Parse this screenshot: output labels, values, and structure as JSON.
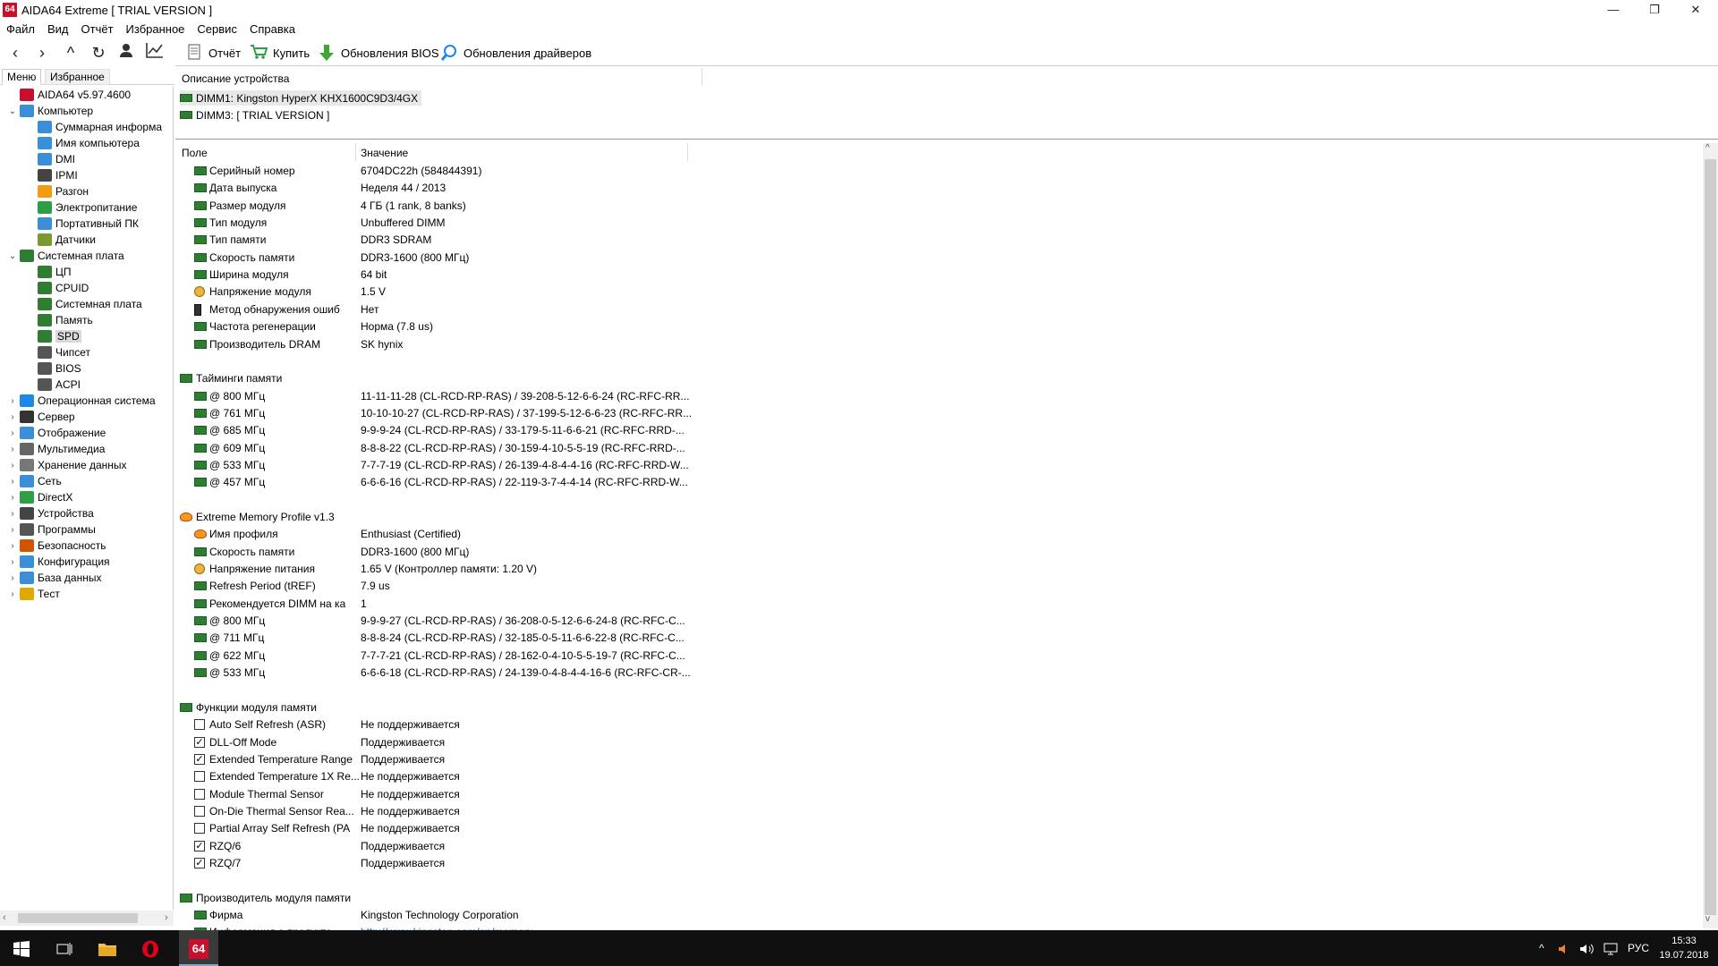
{
  "window": {
    "app_icon": "64",
    "title": "AIDA64 Extreme  [ TRIAL VERSION ]",
    "minimize": "—",
    "restore": "❐",
    "close": "✕"
  },
  "menu": [
    "Файл",
    "Вид",
    "Отчёт",
    "Избранное",
    "Сервис",
    "Справка"
  ],
  "toolbar": {
    "nav_icons": [
      "back-icon",
      "forward-icon",
      "up-icon",
      "refresh-icon",
      "user-icon",
      "chart-icon"
    ],
    "report_label": "Отчёт",
    "buy_label": "Купить",
    "bios_update_label": "Обновления BIOS",
    "driver_update_label": "Обновления драйверов"
  },
  "left_tabs": {
    "menu": "Меню",
    "favorites": "Избранное"
  },
  "tree": [
    {
      "label": "AIDA64 v5.97.4600",
      "level": 0,
      "expander": "",
      "icon_color": "#c8102e"
    },
    {
      "label": "Компьютер",
      "level": 0,
      "expander": "⌄",
      "icon_color": "#3a8fd8"
    },
    {
      "label": "Суммарная информа",
      "level": 1,
      "expander": "",
      "icon_color": "#3a8fd8"
    },
    {
      "label": "Имя компьютера",
      "level": 1,
      "expander": "",
      "icon_color": "#3a8fd8"
    },
    {
      "label": "DMI",
      "level": 1,
      "expander": "",
      "icon_color": "#3a8fd8"
    },
    {
      "label": "IPMI",
      "level": 1,
      "expander": "",
      "icon_color": "#444444"
    },
    {
      "label": "Разгон",
      "level": 1,
      "expander": "",
      "icon_color": "#f39c12"
    },
    {
      "label": "Электропитание",
      "level": 1,
      "expander": "",
      "icon_color": "#2e9e44"
    },
    {
      "label": "Портативный ПК",
      "level": 1,
      "expander": "",
      "icon_color": "#3a8fd8"
    },
    {
      "label": "Датчики",
      "level": 1,
      "expander": "",
      "icon_color": "#7a9a2e"
    },
    {
      "label": "Системная плата",
      "level": 0,
      "expander": "⌄",
      "icon_color": "#2e7d32"
    },
    {
      "label": "ЦП",
      "level": 1,
      "expander": "",
      "icon_color": "#2e7d32"
    },
    {
      "label": "CPUID",
      "level": 1,
      "expander": "",
      "icon_color": "#2e7d32"
    },
    {
      "label": "Системная плата",
      "level": 1,
      "expander": "",
      "icon_color": "#2e7d32"
    },
    {
      "label": "Память",
      "level": 1,
      "expander": "",
      "icon_color": "#2e7d32"
    },
    {
      "label": "SPD",
      "level": 1,
      "expander": "",
      "icon_color": "#2e7d32",
      "selected": true
    },
    {
      "label": "Чипсет",
      "level": 1,
      "expander": "",
      "icon_color": "#555555"
    },
    {
      "label": "BIOS",
      "level": 1,
      "expander": "",
      "icon_color": "#555555"
    },
    {
      "label": "ACPI",
      "level": 1,
      "expander": "",
      "icon_color": "#555555"
    },
    {
      "label": "Операционная система",
      "level": 0,
      "expander": "›",
      "icon_color": "#1e88e5"
    },
    {
      "label": "Сервер",
      "level": 0,
      "expander": "›",
      "icon_color": "#333333"
    },
    {
      "label": "Отображение",
      "level": 0,
      "expander": "›",
      "icon_color": "#3a8fd8"
    },
    {
      "label": "Мультимедиа",
      "level": 0,
      "expander": "›",
      "icon_color": "#666666"
    },
    {
      "label": "Хранение данных",
      "level": 0,
      "expander": "›",
      "icon_color": "#777777"
    },
    {
      "label": "Сеть",
      "level": 0,
      "expander": "›",
      "icon_color": "#3a8fd8"
    },
    {
      "label": "DirectX",
      "level": 0,
      "expander": "›",
      "icon_color": "#2ea043"
    },
    {
      "label": "Устройства",
      "level": 0,
      "expander": "›",
      "icon_color": "#444444"
    },
    {
      "label": "Программы",
      "level": 0,
      "expander": "›",
      "icon_color": "#555555"
    },
    {
      "label": "Безопасность",
      "level": 0,
      "expander": "›",
      "icon_color": "#d35400"
    },
    {
      "label": "Конфигурация",
      "level": 0,
      "expander": "›",
      "icon_color": "#3a8fd8"
    },
    {
      "label": "База данных",
      "level": 0,
      "expander": "›",
      "icon_color": "#3a8fd8"
    },
    {
      "label": "Тест",
      "level": 0,
      "expander": "›",
      "icon_color": "#e0a800"
    }
  ],
  "device_panel": {
    "header": "Описание устройства",
    "items": [
      "DIMM1: Kingston HyperX KHX1600C9D3/4GX",
      "DIMM3: [ TRIAL VERSION ]"
    ]
  },
  "detail_headers": {
    "field": "Поле",
    "value": "Значение"
  },
  "detail_rows": [
    {
      "type": "item",
      "field": "Серийный номер",
      "value": "6704DC22h (584844391)"
    },
    {
      "type": "item",
      "field": "Дата выпуска",
      "value": "Неделя 44 / 2013"
    },
    {
      "type": "item",
      "field": "Размер модуля",
      "value": "4 ГБ (1 rank, 8 banks)"
    },
    {
      "type": "item",
      "field": "Тип модуля",
      "value": "Unbuffered DIMM"
    },
    {
      "type": "item",
      "field": "Тип памяти",
      "value": "DDR3 SDRAM"
    },
    {
      "type": "item",
      "field": "Скорость памяти",
      "value": "DDR3-1600 (800 МГц)"
    },
    {
      "type": "item",
      "field": "Ширина модуля",
      "value": "64 bit"
    },
    {
      "type": "item",
      "field": "Напряжение модуля",
      "value": "1.5 V",
      "icon": "voltage"
    },
    {
      "type": "item",
      "field": "Метод обнаружения ошиб",
      "value": "Нет",
      "icon": "device"
    },
    {
      "type": "item",
      "field": "Частота регенерации",
      "value": "Норма (7.8 us)"
    },
    {
      "type": "item",
      "field": "Производитель DRAM",
      "value": "SK hynix"
    },
    {
      "type": "blank"
    },
    {
      "type": "section",
      "field": "Тайминги памяти"
    },
    {
      "type": "item",
      "field": "@ 800 МГц",
      "value": "11-11-11-28  (CL-RCD-RP-RAS) / 39-208-5-12-6-6-24  (RC-RFC-RR..."
    },
    {
      "type": "item",
      "field": "@ 761 МГц",
      "value": "10-10-10-27  (CL-RCD-RP-RAS) / 37-199-5-12-6-6-23  (RC-RFC-RR..."
    },
    {
      "type": "item",
      "field": "@ 685 МГц",
      "value": "9-9-9-24  (CL-RCD-RP-RAS) / 33-179-5-11-6-6-21  (RC-RFC-RRD-..."
    },
    {
      "type": "item",
      "field": "@ 609 МГц",
      "value": "8-8-8-22  (CL-RCD-RP-RAS) / 30-159-4-10-5-5-19  (RC-RFC-RRD-..."
    },
    {
      "type": "item",
      "field": "@ 533 МГц",
      "value": "7-7-7-19  (CL-RCD-RP-RAS) / 26-139-4-8-4-4-16  (RC-RFC-RRD-W..."
    },
    {
      "type": "item",
      "field": "@ 457 МГц",
      "value": "6-6-6-16  (CL-RCD-RP-RAS) / 22-119-3-7-4-4-14  (RC-RFC-RRD-W..."
    },
    {
      "type": "blank"
    },
    {
      "type": "section",
      "field": "Extreme Memory Profile v1.3",
      "icon": "flame"
    },
    {
      "type": "item",
      "field": "Имя профиля",
      "value": "Enthusiast (Certified)",
      "icon": "flame"
    },
    {
      "type": "item",
      "field": "Скорость памяти",
      "value": "DDR3-1600 (800 МГц)"
    },
    {
      "type": "item",
      "field": "Напряжение питания",
      "value": "1.65 V  (Контроллер памяти: 1.20 V)",
      "icon": "voltage"
    },
    {
      "type": "item",
      "field": "Refresh Period (tREF)",
      "value": "7.9 us"
    },
    {
      "type": "item",
      "field": "Рекомендуется DIMM на ка",
      "value": "1"
    },
    {
      "type": "item",
      "field": "@ 800 МГц",
      "value": "9-9-9-27  (CL-RCD-RP-RAS) / 36-208-0-5-12-6-6-24-8  (RC-RFC-C..."
    },
    {
      "type": "item",
      "field": "@ 711 МГц",
      "value": "8-8-8-24  (CL-RCD-RP-RAS) / 32-185-0-5-11-6-6-22-8  (RC-RFC-C..."
    },
    {
      "type": "item",
      "field": "@ 622 МГц",
      "value": "7-7-7-21  (CL-RCD-RP-RAS) / 28-162-0-4-10-5-5-19-7  (RC-RFC-C..."
    },
    {
      "type": "item",
      "field": "@ 533 МГц",
      "value": "6-6-6-18  (CL-RCD-RP-RAS) / 24-139-0-4-8-4-4-16-6  (RC-RFC-CR-..."
    },
    {
      "type": "blank"
    },
    {
      "type": "section",
      "field": "Функции модуля памяти"
    },
    {
      "type": "check",
      "checked": false,
      "field": "Auto Self Refresh (ASR)",
      "value": "Не поддерживается"
    },
    {
      "type": "check",
      "checked": true,
      "field": "DLL-Off Mode",
      "value": "Поддерживается"
    },
    {
      "type": "check",
      "checked": true,
      "field": "Extended Temperature Range",
      "value": "Поддерживается"
    },
    {
      "type": "check",
      "checked": false,
      "field": "Extended Temperature 1X Re...",
      "value": "Не поддерживается"
    },
    {
      "type": "check",
      "checked": false,
      "field": "Module Thermal Sensor",
      "value": "Не поддерживается"
    },
    {
      "type": "check",
      "checked": false,
      "field": "On-Die Thermal Sensor Rea...",
      "value": "Не поддерживается"
    },
    {
      "type": "check",
      "checked": false,
      "field": "Partial Array Self Refresh (PA",
      "value": "Не поддерживается"
    },
    {
      "type": "check",
      "checked": true,
      "field": "RZQ/6",
      "value": "Поддерживается"
    },
    {
      "type": "check",
      "checked": true,
      "field": "RZQ/7",
      "value": "Поддерживается"
    },
    {
      "type": "blank"
    },
    {
      "type": "section",
      "field": "Производитель модуля памяти"
    },
    {
      "type": "item",
      "field": "Фирма",
      "value": "Kingston Technology Corporation"
    },
    {
      "type": "item",
      "field": "Информация о продукте",
      "value": "http://www.kingston.com/en/memory",
      "link": true
    }
  ],
  "taskbar": {
    "apps": [
      "windows-start-icon",
      "task-view-icon",
      "file-explorer-icon",
      "opera-icon",
      "aida64-icon"
    ],
    "aida_label": "64",
    "language": "РУС",
    "time": "15:33",
    "date": "19.07.2018"
  }
}
